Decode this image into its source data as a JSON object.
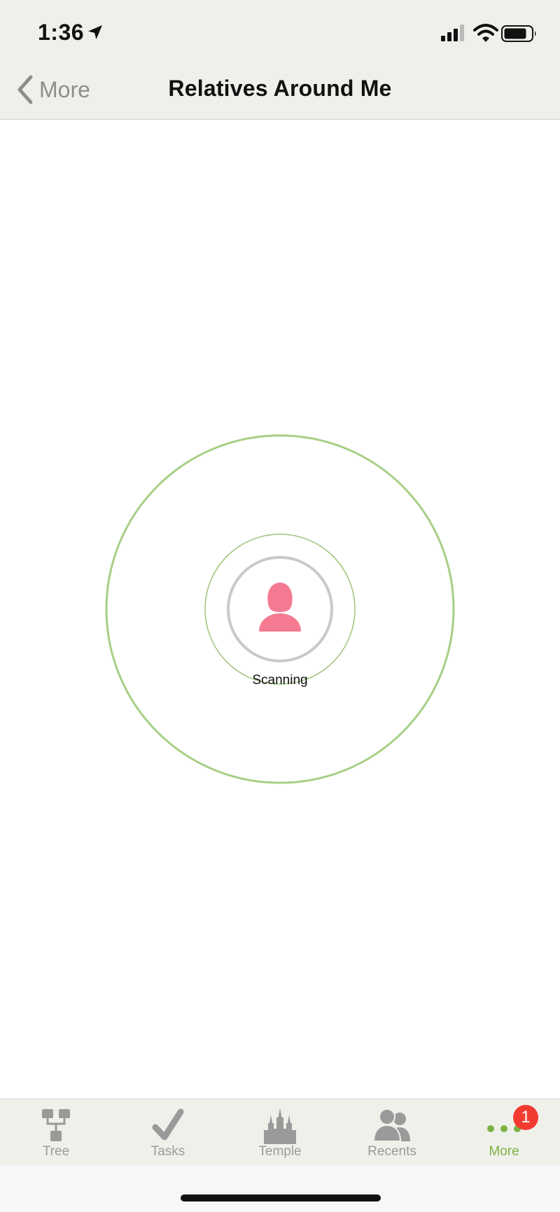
{
  "status_bar": {
    "time": "1:36",
    "icons": [
      "location-arrow-icon",
      "cellular-signal-icon",
      "wifi-icon",
      "battery-icon"
    ]
  },
  "nav": {
    "back_label": "More",
    "title": "Relatives Around Me"
  },
  "scan": {
    "status_text": "Scanning",
    "avatar_icon": "female-person-icon",
    "colors": {
      "ring": "#a8cf86",
      "avatar": "#f47a92",
      "avatar_ring": "#c9c9c9"
    }
  },
  "tabs": [
    {
      "label": "Tree",
      "icon": "tree-icon"
    },
    {
      "label": "Tasks",
      "icon": "checkmark-icon"
    },
    {
      "label": "Temple",
      "icon": "temple-icon"
    },
    {
      "label": "Recents",
      "icon": "people-icon"
    },
    {
      "label": "More",
      "icon": "more-dots-icon",
      "active": true
    }
  ],
  "more_badge": "1",
  "colors": {
    "accent": "#7cb342",
    "tab_inactive": "#9a9a9a",
    "badge": "#f23b30",
    "bar_background": "#f0f0eb"
  }
}
